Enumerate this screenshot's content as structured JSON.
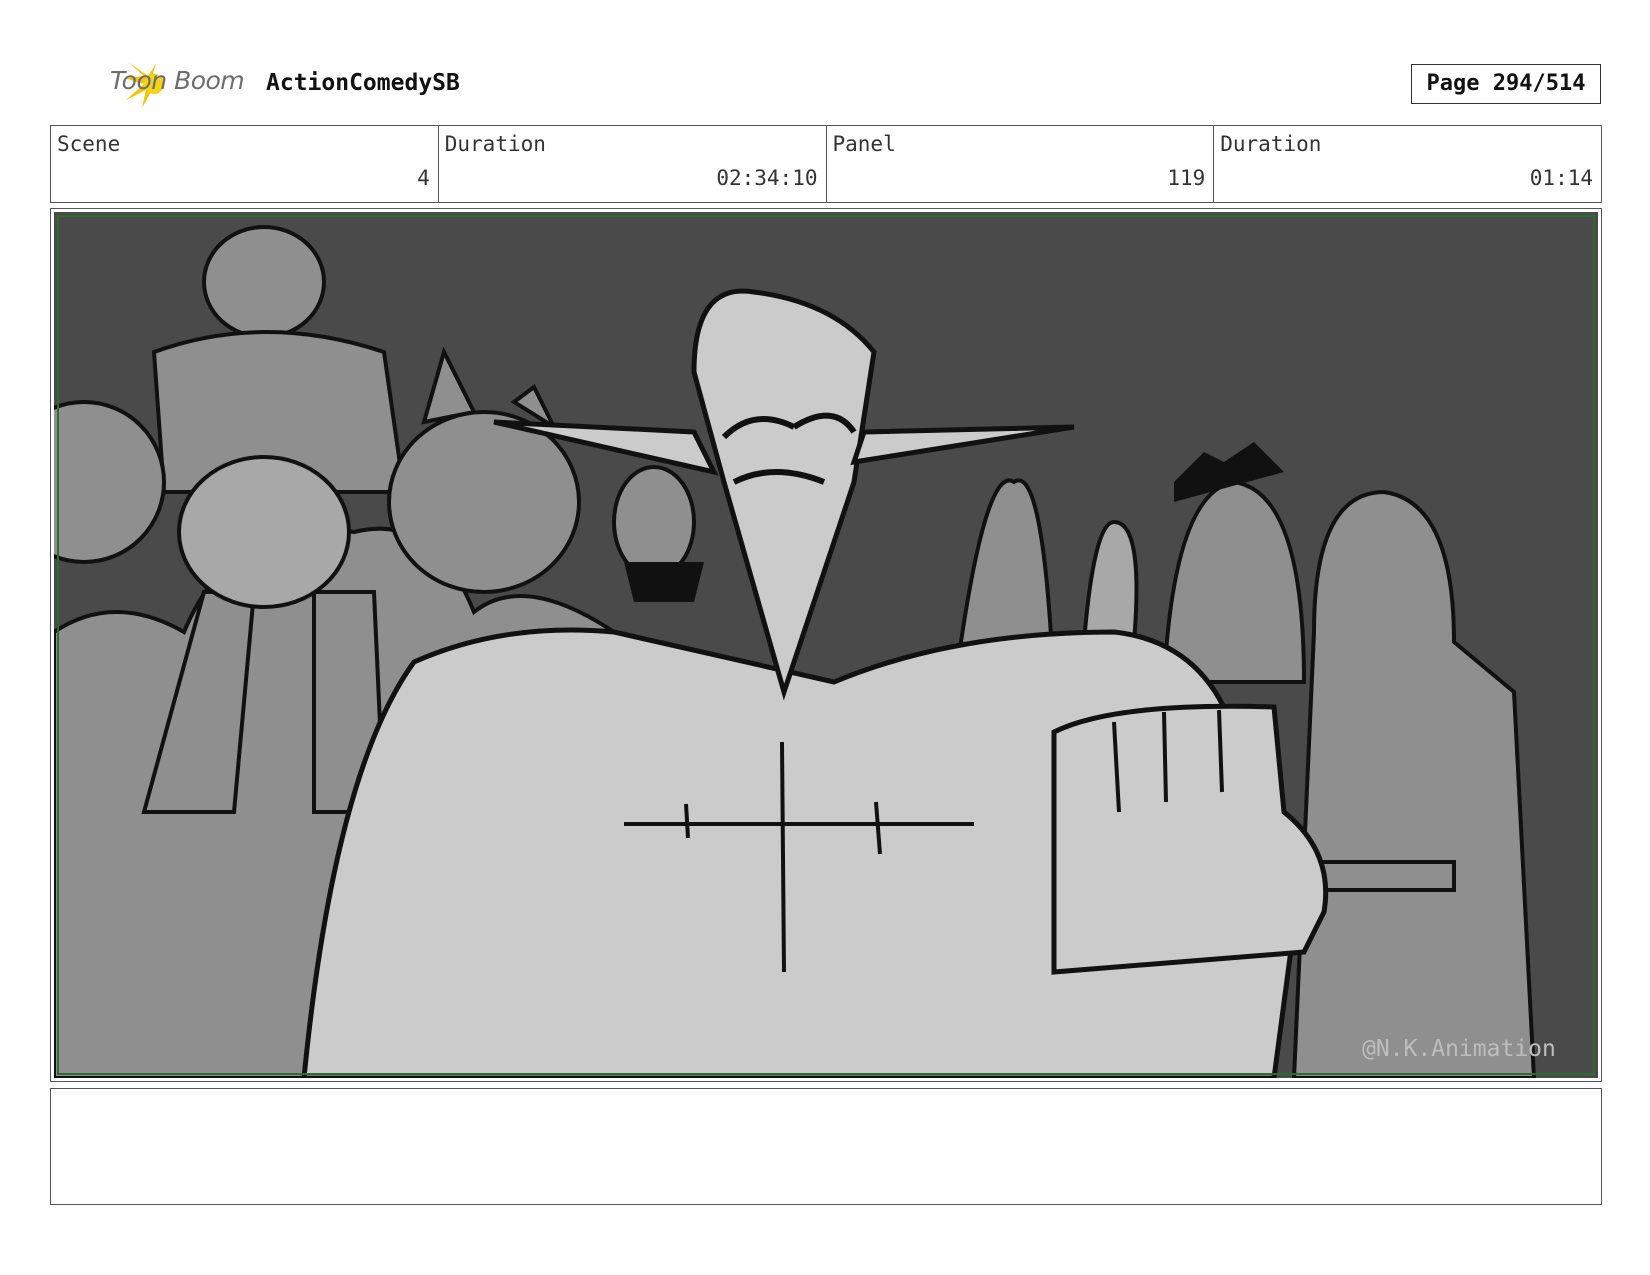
{
  "header": {
    "logo_text": "Toon Boom",
    "project": "ActionComedySB",
    "page": "Page 294/514"
  },
  "info": {
    "scene_label": "Scene",
    "scene_value": "4",
    "scene_duration_label": "Duration",
    "scene_duration_value": "02:34:10",
    "panel_label": "Panel",
    "panel_value": "119",
    "panel_duration_label": "Duration",
    "panel_duration_value": "01:14"
  },
  "panel": {
    "watermark": "@N.K.Animation"
  },
  "notes": {
    "text": ""
  },
  "colors": {
    "logo_yellow": "#f5c400",
    "background_dark": "#4a4a4a",
    "figure_light": "#cbcbcb",
    "crowd_mid": "#8f8f8f",
    "safe_area": "#2e6b2e"
  }
}
